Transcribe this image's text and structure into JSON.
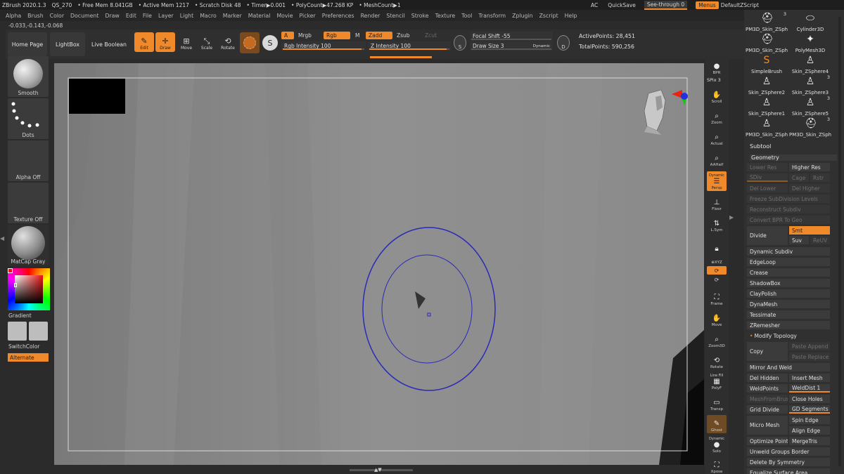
{
  "titlebar": {
    "app": "ZBrush 2020.1.3",
    "qs": "QS_270",
    "free_mem": "• Free Mem 8.041GB",
    "active_mem": "• Active Mem 1217",
    "scratch": "• Scratch Disk 48",
    "timer": "• Timer▶0.001",
    "polycount": "• PolyCount▶47.268 KP",
    "meshcount": "• MeshCount▶1",
    "ac": "AC",
    "quicksave": "QuickSave",
    "see_through": "See-through  0",
    "menus": "Menus",
    "script": "DefaultZScript"
  },
  "menubar": [
    "Alpha",
    "Brush",
    "Color",
    "Document",
    "Draw",
    "Edit",
    "File",
    "Layer",
    "Light",
    "Macro",
    "Marker",
    "Material",
    "Movie",
    "Picker",
    "Preferences",
    "Render",
    "Stencil",
    "Stroke",
    "Texture",
    "Tool",
    "Transform",
    "Zplugin",
    "Zscript",
    "Help"
  ],
  "coords": "-0.033,-0.143,-0.068",
  "toolbar": {
    "home": "Home Page",
    "lightbox": "LightBox",
    "live_boolean": "Live Boolean",
    "edit": "Edit",
    "draw": "Draw",
    "move": "Move",
    "scale": "Scale",
    "rotate": "Rotate",
    "a": "A",
    "mrgb": "Mrgb",
    "rgb": "Rgb",
    "m": "M",
    "zadd": "Zadd",
    "zsub": "Zsub",
    "zcut": "Zcut",
    "rgb_intensity": "Rgb Intensity 100",
    "rgb_intensity_pct": 100,
    "z_intensity": "Z Intensity 100",
    "z_intensity_pct": 100,
    "focal_shift": "Focal Shift -55",
    "draw_size": "Draw Size 3",
    "dynamic": "Dynamic",
    "active_points": "ActivePoints: 28,451",
    "total_points": "TotalPoints: 590,256",
    "s_label": "S",
    "d_label": "D"
  },
  "leftshelf": {
    "smooth": "Smooth",
    "dots": "Dots",
    "alpha_off": "Alpha Off",
    "texture_off": "Texture Off",
    "matcap": "MatCap Gray",
    "gradient": "Gradient",
    "switch_color": "SwitchColor",
    "alternate": "Alternate"
  },
  "rightshelf": {
    "bpr": "BPR",
    "spix": "SPix 3",
    "scroll": "Scroll",
    "zoom": "Zoom",
    "actual": "Actual",
    "aahalf": "AAHalf",
    "dynamic": "Dynamic",
    "persp": "Persp",
    "floor": "Floor",
    "lsym": "L.Sym",
    "xyz": "⊕XYZ",
    "frame": "Frame",
    "move": "Move",
    "zoom3d": "Zoom3D",
    "rotate": "Rotate",
    "line_fill": "Line Fill",
    "polyf": "PolyF",
    "transp": "Transp",
    "ghost": "Ghost",
    "solo_dynamic": "Dynamic",
    "solo": "Solo",
    "xpose": "Xpose"
  },
  "tools": [
    {
      "label": "PM3D_Skin_ZSph",
      "count": "3",
      "icon": "helmet-icon"
    },
    {
      "label": "Cylinder3D",
      "count": "",
      "icon": "cylinder-icon"
    },
    {
      "label": "PM3D_Skin_ZSph",
      "count": "",
      "icon": "helmet-icon"
    },
    {
      "label": "PolyMesh3D",
      "count": "",
      "icon": "star-icon"
    },
    {
      "label": "SimpleBrush",
      "count": "",
      "icon": "s-brush-icon"
    },
    {
      "label": "Skin_ZSphere4",
      "count": "",
      "icon": "figure-icon"
    },
    {
      "label": "Skin_ZSphere2",
      "count": "",
      "icon": "figure-icon"
    },
    {
      "label": "Skin_ZSphere3",
      "count": "3",
      "icon": "figure-icon"
    },
    {
      "label": "Skin_ZSphere1",
      "count": "",
      "icon": "figure-icon"
    },
    {
      "label": "Skin_ZSphere5",
      "count": "3",
      "icon": "figure-icon"
    },
    {
      "label": "PM3D_Skin_ZSph",
      "count": "",
      "icon": "figure-icon"
    },
    {
      "label": "PM3D_Skin_ZSph",
      "count": "3",
      "icon": "helmet-icon"
    }
  ],
  "panel": {
    "subtool": "Subtool",
    "geometry": "Geometry",
    "lower_res": "Lower Res",
    "higher_res": "Higher Res",
    "sdiv": "SDiv",
    "cage": "Cage",
    "rstr": "Rstr",
    "del_lower": "Del Lower",
    "del_higher": "Del Higher",
    "freeze": "Freeze SubDivision Levels",
    "reconstruct": "Reconstruct Subdiv",
    "convert": "Convert BPR To Geo",
    "divide": "Divide",
    "smt": "Smt",
    "suv": "Suv",
    "reuv": "ReUV",
    "dynamic_subdiv": "Dynamic Subdiv",
    "edgeloop": "EdgeLoop",
    "crease": "Crease",
    "shadowbox": "ShadowBox",
    "claypolish": "ClayPolish",
    "dynamesh": "DynaMesh",
    "tessimate": "Tessimate",
    "zremesher": "ZRemesher",
    "modify_topology": "Modify Topology",
    "copy": "Copy",
    "paste_append": "Paste Append",
    "paste_replace": "Paste Replace",
    "mirror_weld": "Mirror And Weld",
    "del_hidden": "Del Hidden",
    "insert_mesh": "Insert Mesh",
    "weldpoints": "WeldPoints",
    "welddist": "WeldDist 1",
    "mesh_from_brush": "MeshFromBrush",
    "close_holes": "Close Holes",
    "grid_divide": "Grid Divide",
    "gd_segments": "GD Segments 3",
    "micro_mesh": "Micro Mesh",
    "spin_edge": "Spin Edge",
    "align_edge": "Align Edge",
    "optimize_points": "Optimize Points",
    "merge_tris": "MergeTris",
    "unweld_groups": "Unweld Groups Border",
    "delete_symmetry": "Delete By Symmetry",
    "equalize": "Equalize Surface Area"
  },
  "colors": {
    "accent": "#f0892a",
    "canvas": "#8a8a8a",
    "brush_ring": "#2a2ab8"
  }
}
